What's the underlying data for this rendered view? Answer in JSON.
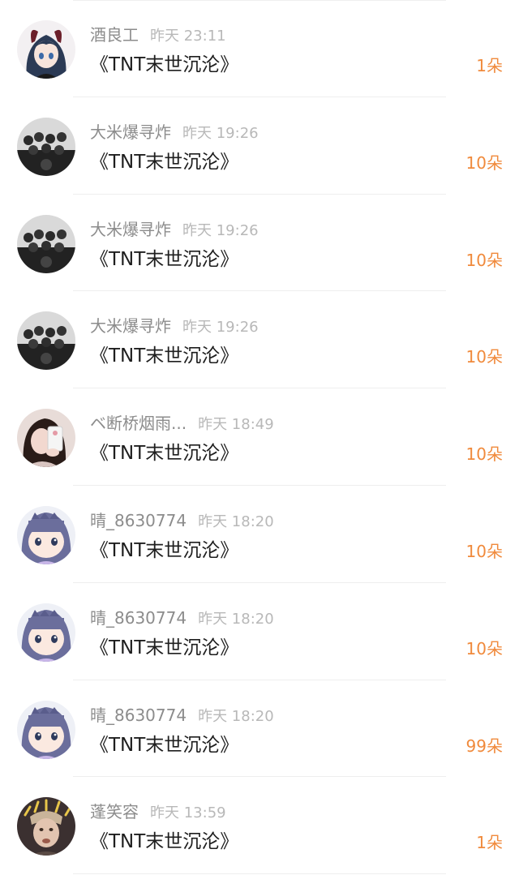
{
  "items": [
    {
      "username": "酒良工",
      "time": "昨天 23:11",
      "title": "《TNT末世沉沦》",
      "count": "1朵",
      "avatar_icon": "anime-girl-horns-icon"
    },
    {
      "username": "大米爆寻炸",
      "time": "昨天 19:26",
      "title": "《TNT末世沉沦》",
      "count": "10朵",
      "avatar_icon": "group-photo-icon"
    },
    {
      "username": "大米爆寻炸",
      "time": "昨天 19:26",
      "title": "《TNT末世沉沦》",
      "count": "10朵",
      "avatar_icon": "group-photo-icon"
    },
    {
      "username": "大米爆寻炸",
      "time": "昨天 19:26",
      "title": "《TNT末世沉沦》",
      "count": "10朵",
      "avatar_icon": "group-photo-icon"
    },
    {
      "username": "ベ断桥烟雨...",
      "time": "昨天 18:49",
      "title": "《TNT末世沉沦》",
      "count": "10朵",
      "avatar_icon": "selfie-girl-icon"
    },
    {
      "username": "晴_8630774",
      "time": "昨天 18:20",
      "title": "《TNT末世沉沦》",
      "count": "10朵",
      "avatar_icon": "chibi-girl-icon"
    },
    {
      "username": "晴_8630774",
      "time": "昨天 18:20",
      "title": "《TNT末世沉沦》",
      "count": "10朵",
      "avatar_icon": "chibi-girl-icon"
    },
    {
      "username": "晴_8630774",
      "time": "昨天 18:20",
      "title": "《TNT末世沉沦》",
      "count": "99朵",
      "avatar_icon": "chibi-girl-icon"
    },
    {
      "username": "蓬笑容",
      "time": "昨天 13:59",
      "title": "《TNT末世沉沦》",
      "count": "1朵",
      "avatar_icon": "meme-face-icon"
    }
  ],
  "colors": {
    "accent": "#f08a3c",
    "username": "#8c8c8c",
    "time": "#b8b8b8",
    "title": "#1e1e1e",
    "divider": "#eeeeee"
  }
}
